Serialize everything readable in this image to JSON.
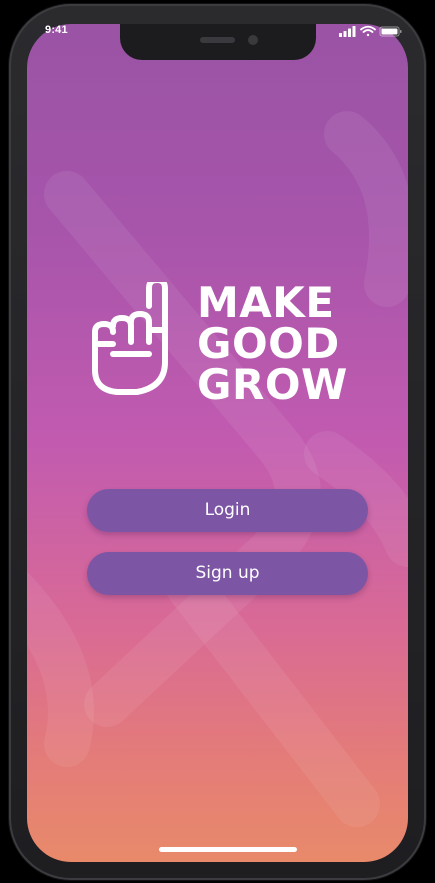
{
  "status_bar": {
    "time": "9:41",
    "icons": [
      "signal-icon",
      "wifi-icon",
      "battery-icon"
    ]
  },
  "logo": {
    "icon": "pointing-hand-icon",
    "lines": [
      "MAKE",
      "GOOD",
      "GROW"
    ]
  },
  "actions": {
    "login_label": "Login",
    "signup_label": "Sign up"
  },
  "colors": {
    "gradient_top": "#9a53a5",
    "gradient_mid": "#c25bb0",
    "gradient_bottom": "#e88a6a",
    "button_fill": "#7c56a5",
    "text": "#ffffff"
  }
}
